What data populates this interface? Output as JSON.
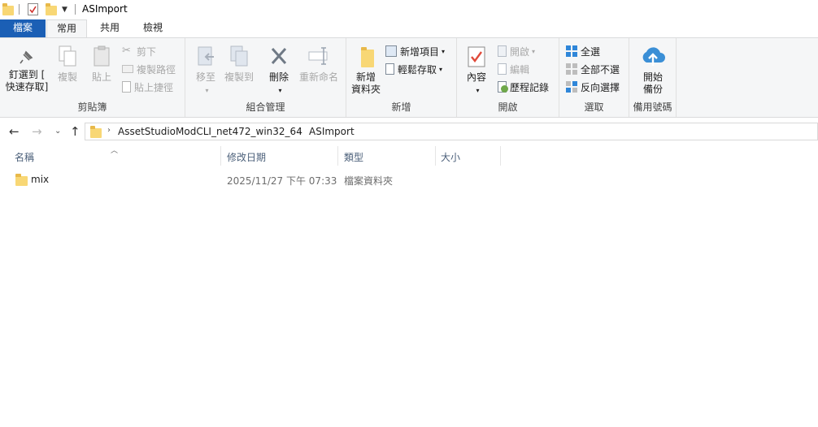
{
  "window": {
    "title": "ASImport"
  },
  "ribbon_tabs": {
    "file": "檔案",
    "home": "常用",
    "share": "共用",
    "view": "檢視"
  },
  "clipboard": {
    "label": "剪貼簿",
    "pin_line1": "釘選到 [",
    "pin_line2": "快速存取]",
    "copy": "複製",
    "paste": "貼上",
    "cut": "剪下",
    "copy_path": "複製路徑",
    "paste_shortcut": "貼上捷徑"
  },
  "organize": {
    "label": "組合管理",
    "move_to": "移至",
    "copy_to": "複製到",
    "delete": "刪除",
    "rename": "重新命名"
  },
  "new": {
    "label": "新增",
    "new_folder_line1": "新增",
    "new_folder_line2": "資料夾",
    "new_item": "新增項目",
    "easy_access": "輕鬆存取"
  },
  "open": {
    "label": "開啟",
    "properties": "內容",
    "open": "開啟",
    "edit": "編輯",
    "history": "歷程記錄"
  },
  "select": {
    "label": "選取",
    "select_all": "全選",
    "select_none": "全部不選",
    "invert": "反向選擇"
  },
  "backup": {
    "label": "備用號碼",
    "start_line1": "開始",
    "start_line2": "備份"
  },
  "address": {
    "crumbs": [
      "AssetStudioModCLI_net472_win32_64",
      "ASImport"
    ]
  },
  "columns": {
    "name": "名稱",
    "date": "修改日期",
    "type": "類型",
    "size": "大小"
  },
  "files": [
    {
      "name": "mix",
      "date": "2025/11/27 下午 07:33",
      "type": "檔案資料夾",
      "size": ""
    }
  ],
  "colors": {
    "file_tab": "#1b5fb5",
    "folder": "#f8d775",
    "ribbon_bg": "#f5f6f7",
    "header_text": "#4c607a"
  }
}
